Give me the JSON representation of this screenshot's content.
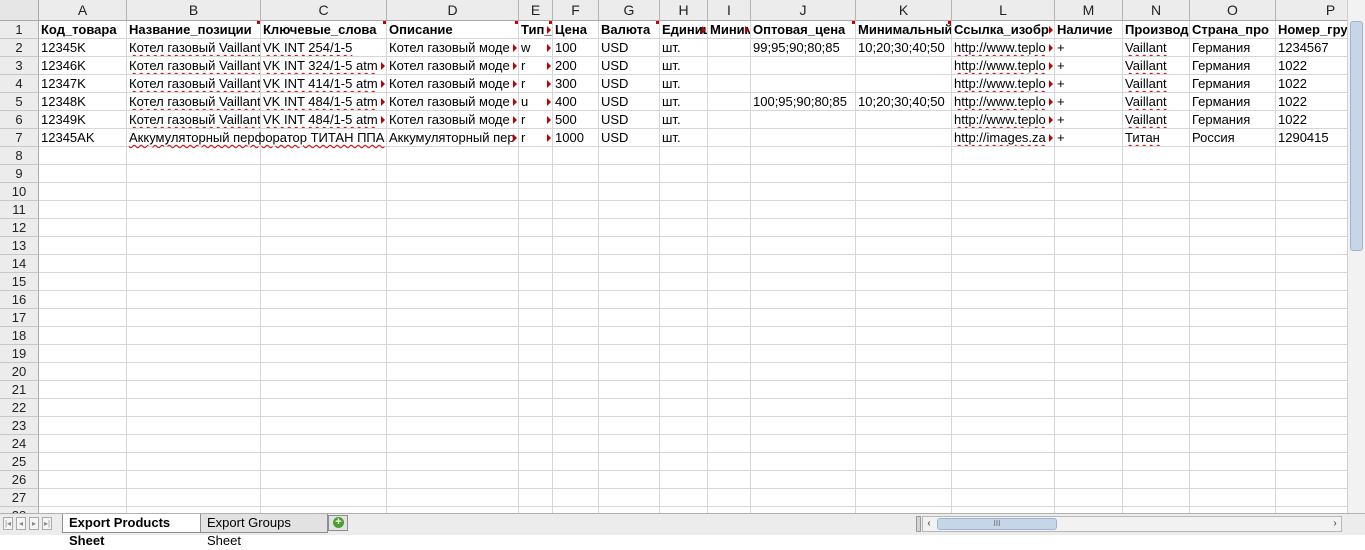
{
  "columns": [
    {
      "letter": "A",
      "w": 88
    },
    {
      "letter": "B",
      "w": 134
    },
    {
      "letter": "C",
      "w": 126
    },
    {
      "letter": "D",
      "w": 132
    },
    {
      "letter": "E",
      "w": 34
    },
    {
      "letter": "F",
      "w": 46
    },
    {
      "letter": "G",
      "w": 61
    },
    {
      "letter": "H",
      "w": 48
    },
    {
      "letter": "I",
      "w": 43
    },
    {
      "letter": "J",
      "w": 105
    },
    {
      "letter": "K",
      "w": 96
    },
    {
      "letter": "L",
      "w": 103
    },
    {
      "letter": "M",
      "w": 68
    },
    {
      "letter": "N",
      "w": 67
    },
    {
      "letter": "O",
      "w": 86
    },
    {
      "letter": "P",
      "w": 110
    }
  ],
  "row_count": 29,
  "header_row": [
    {
      "text": "Код_товара",
      "note": false
    },
    {
      "text": "Название_позиции",
      "note": true
    },
    {
      "text": "Ключевые_слова",
      "note": true
    },
    {
      "text": "Описание",
      "note": true
    },
    {
      "text": "Тип_",
      "note": true,
      "overflow": true
    },
    {
      "text": "Цена",
      "note": false
    },
    {
      "text": "Валюта",
      "note": true
    },
    {
      "text": "Единица",
      "note": false,
      "overflow": true
    },
    {
      "text": "Минимальный",
      "note": false,
      "overflow": true
    },
    {
      "text": "Оптовая_цена",
      "note": true
    },
    {
      "text": "Минимальный",
      "note": true
    },
    {
      "text": "Ссылка_изобр",
      "note": false,
      "overflow": true
    },
    {
      "text": "Наличие",
      "note": false
    },
    {
      "text": "Производ",
      "note": false
    },
    {
      "text": "Страна_про",
      "note": false
    },
    {
      "text": "Номер_гру",
      "note": false
    }
  ],
  "rows": [
    [
      "12345K",
      "Котел газовый Vaillant",
      "VK INT 254/1-5",
      "Котел газовый моде",
      "w",
      "100",
      "USD",
      "шт.",
      "",
      "99;95;90;80;85",
      "10;20;30;40;50",
      "http://www.teplo",
      "+",
      "Vaillant",
      "Германия",
      "1234567"
    ],
    [
      "12346K",
      "Котел газовый Vaillant",
      "VK INT 324/1-5 atm",
      "Котел газовый моде",
      "r",
      "200",
      "USD",
      "шт.",
      "",
      "",
      "",
      "http://www.teplo",
      "+",
      "Vaillant",
      "Германия",
      "1022"
    ],
    [
      "12347K",
      "Котел газовый Vaillant",
      "VK INT 414/1-5 atm",
      "Котел газовый моде",
      "r",
      "300",
      "USD",
      "шт.",
      "",
      "",
      "",
      "http://www.teplo",
      "+",
      "Vaillant",
      "Германия",
      "1022"
    ],
    [
      "12348K",
      "Котел газовый Vaillant",
      "VK INT 484/1-5 atm",
      "Котел газовый моде",
      "u",
      "400",
      "USD",
      "шт.",
      "",
      "100;95;90;80;85",
      "10;20;30;40;50",
      "http://www.teplo",
      "+",
      "Vaillant",
      "Германия",
      "1022"
    ],
    [
      "12349K",
      "Котел газовый Vaillant",
      "VK INT 484/1-5 atm",
      "Котел газовый моде",
      "r",
      "500",
      "USD",
      "шт.",
      "",
      "",
      "",
      "http://www.teplo",
      "+",
      "Vaillant",
      "Германия",
      "1022"
    ],
    [
      "12345AK",
      "Аккумуляторный перфоратор ТИТАН ППА",
      "",
      "Аккумуляторный пер",
      "r",
      "1000",
      "USD",
      "шт.",
      "",
      "",
      "",
      "http://images.za",
      "+",
      "Титан",
      "Россия",
      "1290415"
    ]
  ],
  "tabs": [
    {
      "label": "Export Products Sheet",
      "active": true
    },
    {
      "label": "Export Groups Sheet",
      "active": false
    }
  ],
  "colors": {
    "note": "#cc0000",
    "grid": "#d6d6d6",
    "header_bg": "#ececec",
    "add_tab": "#4aa02c"
  }
}
